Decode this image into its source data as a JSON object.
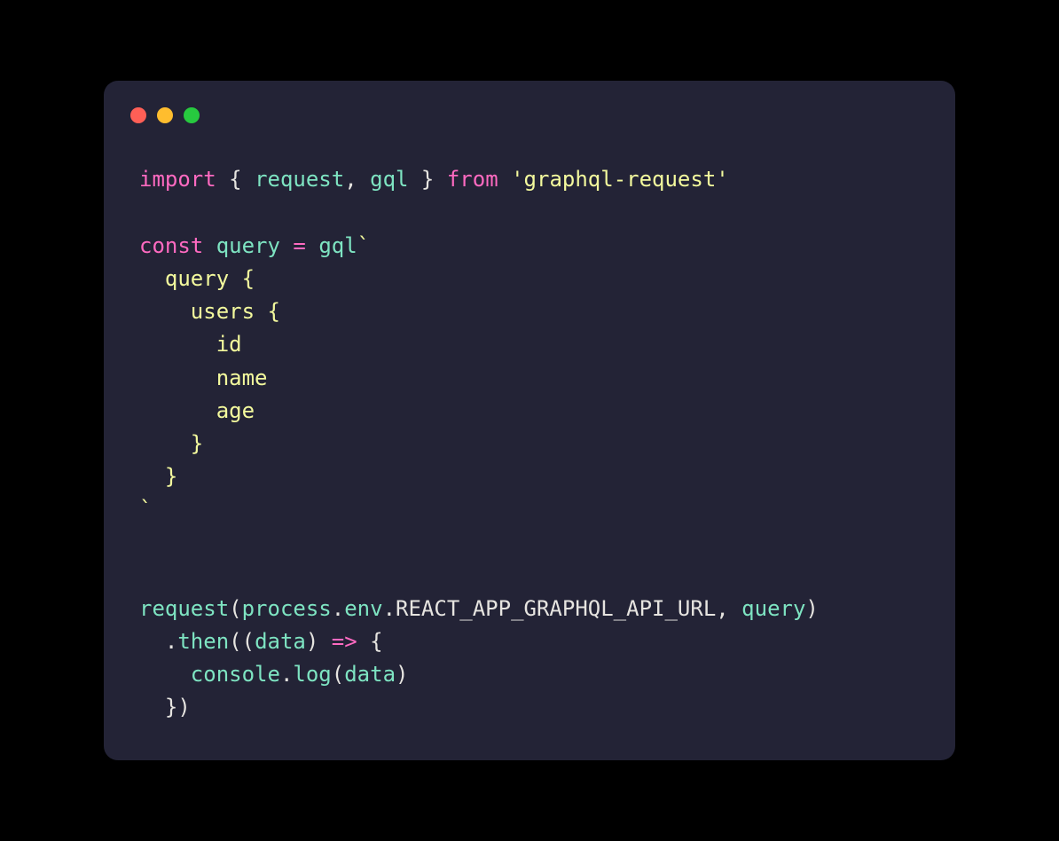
{
  "code": {
    "line1_import": "import",
    "line1_lbrace": " { ",
    "line1_request": "request",
    "line1_comma": ", ",
    "line1_gql": "gql",
    "line1_rbrace": " } ",
    "line1_from": "from",
    "line1_sp": " ",
    "line1_pkg": "'graphql-request'",
    "blank1": "",
    "line3_const": "const",
    "line3_sp1": " ",
    "line3_query": "query",
    "line3_sp2": " ",
    "line3_eq": "=",
    "line3_sp3": " ",
    "line3_gql": "gql",
    "line3_btick": "`",
    "line4": "  query {",
    "line5": "    users {",
    "line6": "      id",
    "line7": "      name",
    "line8": "      age",
    "line9": "    }",
    "line10": "  }",
    "line11": "`",
    "blank2": "",
    "blank3": "",
    "line13_request": "request",
    "line13_lparen": "(",
    "line13_process": "process",
    "line13_dot1": ".",
    "line13_env": "env",
    "line13_dot2": ".",
    "line13_url": "REACT_APP_GRAPHQL_API_URL",
    "line13_comma": ", ",
    "line13_query": "query",
    "line13_rparen": ")",
    "line14_indent": "  ",
    "line14_dot": ".",
    "line14_then": "then",
    "line14_lparen": "(",
    "line14_lparen2": "(",
    "line14_data": "data",
    "line14_rparen": ")",
    "line14_sp": " ",
    "line14_arrow": "=>",
    "line14_sp2": " ",
    "line14_lbrace": "{",
    "line15_indent": "    ",
    "line15_console": "console",
    "line15_dot": ".",
    "line15_log": "log",
    "line15_lparen": "(",
    "line15_data": "data",
    "line15_rparen": ")",
    "line16": "  })"
  }
}
